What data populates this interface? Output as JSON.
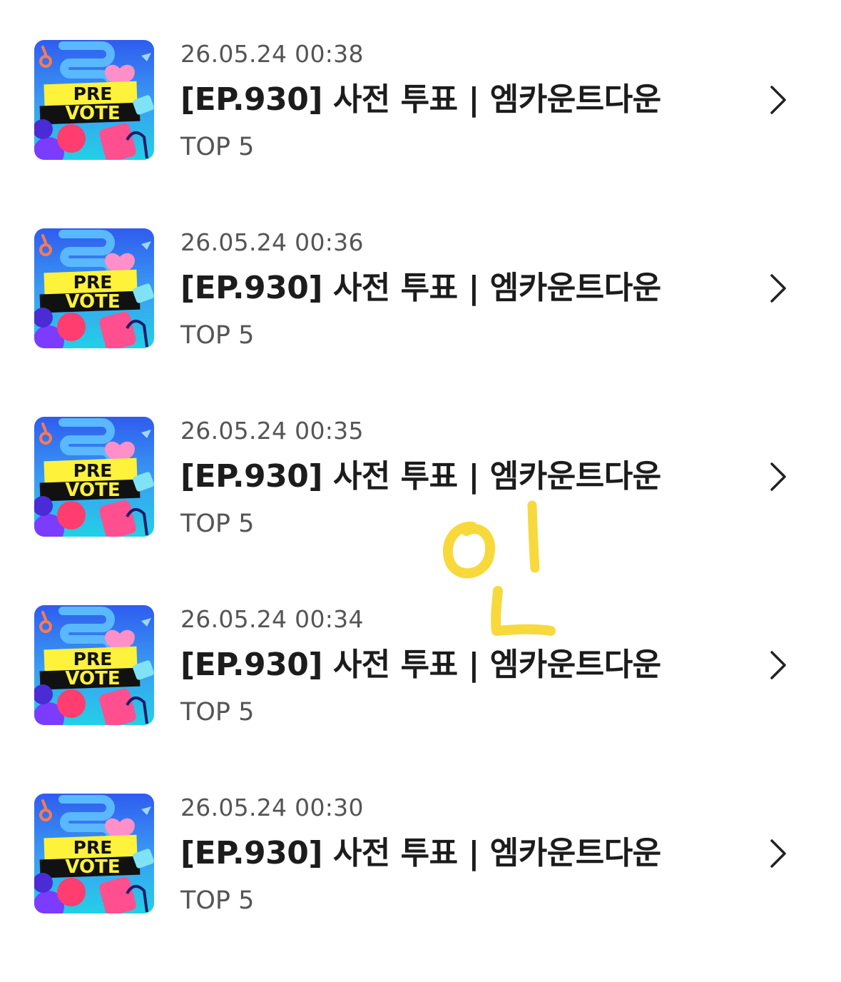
{
  "thumbnail": {
    "line1": "PRE",
    "line2": "VOTE"
  },
  "items": [
    {
      "date": "26.05.24 00:38",
      "title": "[EP.930] 사전 투표 | 엠카운트다운",
      "subtitle": "TOP 5"
    },
    {
      "date": "26.05.24 00:36",
      "title": "[EP.930] 사전 투표 | 엠카운트다운",
      "subtitle": "TOP 5"
    },
    {
      "date": "26.05.24 00:35",
      "title": "[EP.930] 사전 투표 | 엠카운트다운",
      "subtitle": "TOP 5"
    },
    {
      "date": "26.05.24 00:34",
      "title": "[EP.930] 사전 투표 | 엠카운트다운",
      "subtitle": "TOP 5"
    },
    {
      "date": "26.05.24 00:30",
      "title": "[EP.930] 사전 투표 | 엠카운트다운",
      "subtitle": "TOP 5"
    }
  ],
  "icons": {
    "row_arrow": "chevron-right-icon",
    "thumbnail": "pre-vote-thumbnail"
  },
  "colors": {
    "thumb_bg_top": "#2f5cf0",
    "thumb_bg_bottom": "#22d0e6",
    "thumb_banner": "#fff23a",
    "thumb_banner_dark": "#111111",
    "heart": "#ff8fc8",
    "scribble": "#f7d21a"
  }
}
